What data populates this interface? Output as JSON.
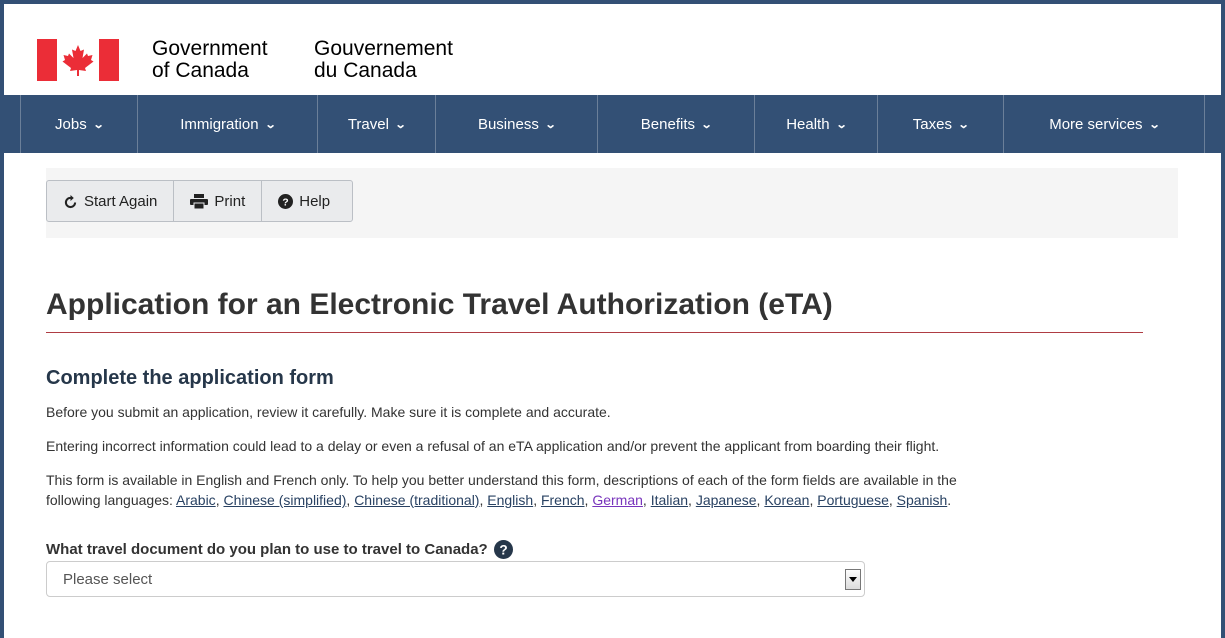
{
  "header": {
    "signature_en_line1": "Government",
    "signature_en_line2": "of Canada",
    "signature_fr_line1": "Gouvernement",
    "signature_fr_line2": "du Canada",
    "flag_icon": "canada-flag-icon",
    "colors": {
      "flag_red": "#eb2d37",
      "menu_bg": "#335075"
    }
  },
  "menu": {
    "items": [
      {
        "label": "Jobs"
      },
      {
        "label": "Immigration"
      },
      {
        "label": "Travel"
      },
      {
        "label": "Business"
      },
      {
        "label": "Benefits"
      },
      {
        "label": "Health"
      },
      {
        "label": "Taxes"
      },
      {
        "label": "More services"
      }
    ],
    "chevron_icon": "chevron-down-icon"
  },
  "toolbar": {
    "start_again_label": "Start Again",
    "start_again_icon": "refresh-icon",
    "print_label": "Print",
    "print_icon": "print-icon",
    "help_label": "Help",
    "help_icon": "question-circle-icon"
  },
  "main": {
    "title": "Application for an Electronic Travel Authorization (eTA)",
    "section_title": "Complete the application form",
    "para1": "Before you submit an application, review it carefully. Make sure it is complete and accurate.",
    "para2": "Entering incorrect information could lead to a delay or even a refusal of an eTA application and/or prevent the applicant from boarding their flight.",
    "para3_line1": "This form is available in English and French only. To help you better understand this form, descriptions of each of the form fields are available in the",
    "para3_prefix": "following languages: ",
    "languages": [
      {
        "label": "Arabic",
        "visited": false
      },
      {
        "label": "Chinese (simplified)",
        "visited": false
      },
      {
        "label": "Chinese (traditional)",
        "visited": false
      },
      {
        "label": "English",
        "visited": false
      },
      {
        "label": "French",
        "visited": false
      },
      {
        "label": "German",
        "visited": true
      },
      {
        "label": "Italian",
        "visited": false
      },
      {
        "label": "Japanese",
        "visited": false
      },
      {
        "label": "Korean",
        "visited": false
      },
      {
        "label": "Portuguese",
        "visited": false
      },
      {
        "label": "Spanish",
        "visited": false
      }
    ],
    "question": "What travel document do you plan to use to travel to Canada?",
    "select_value": "Please select"
  }
}
